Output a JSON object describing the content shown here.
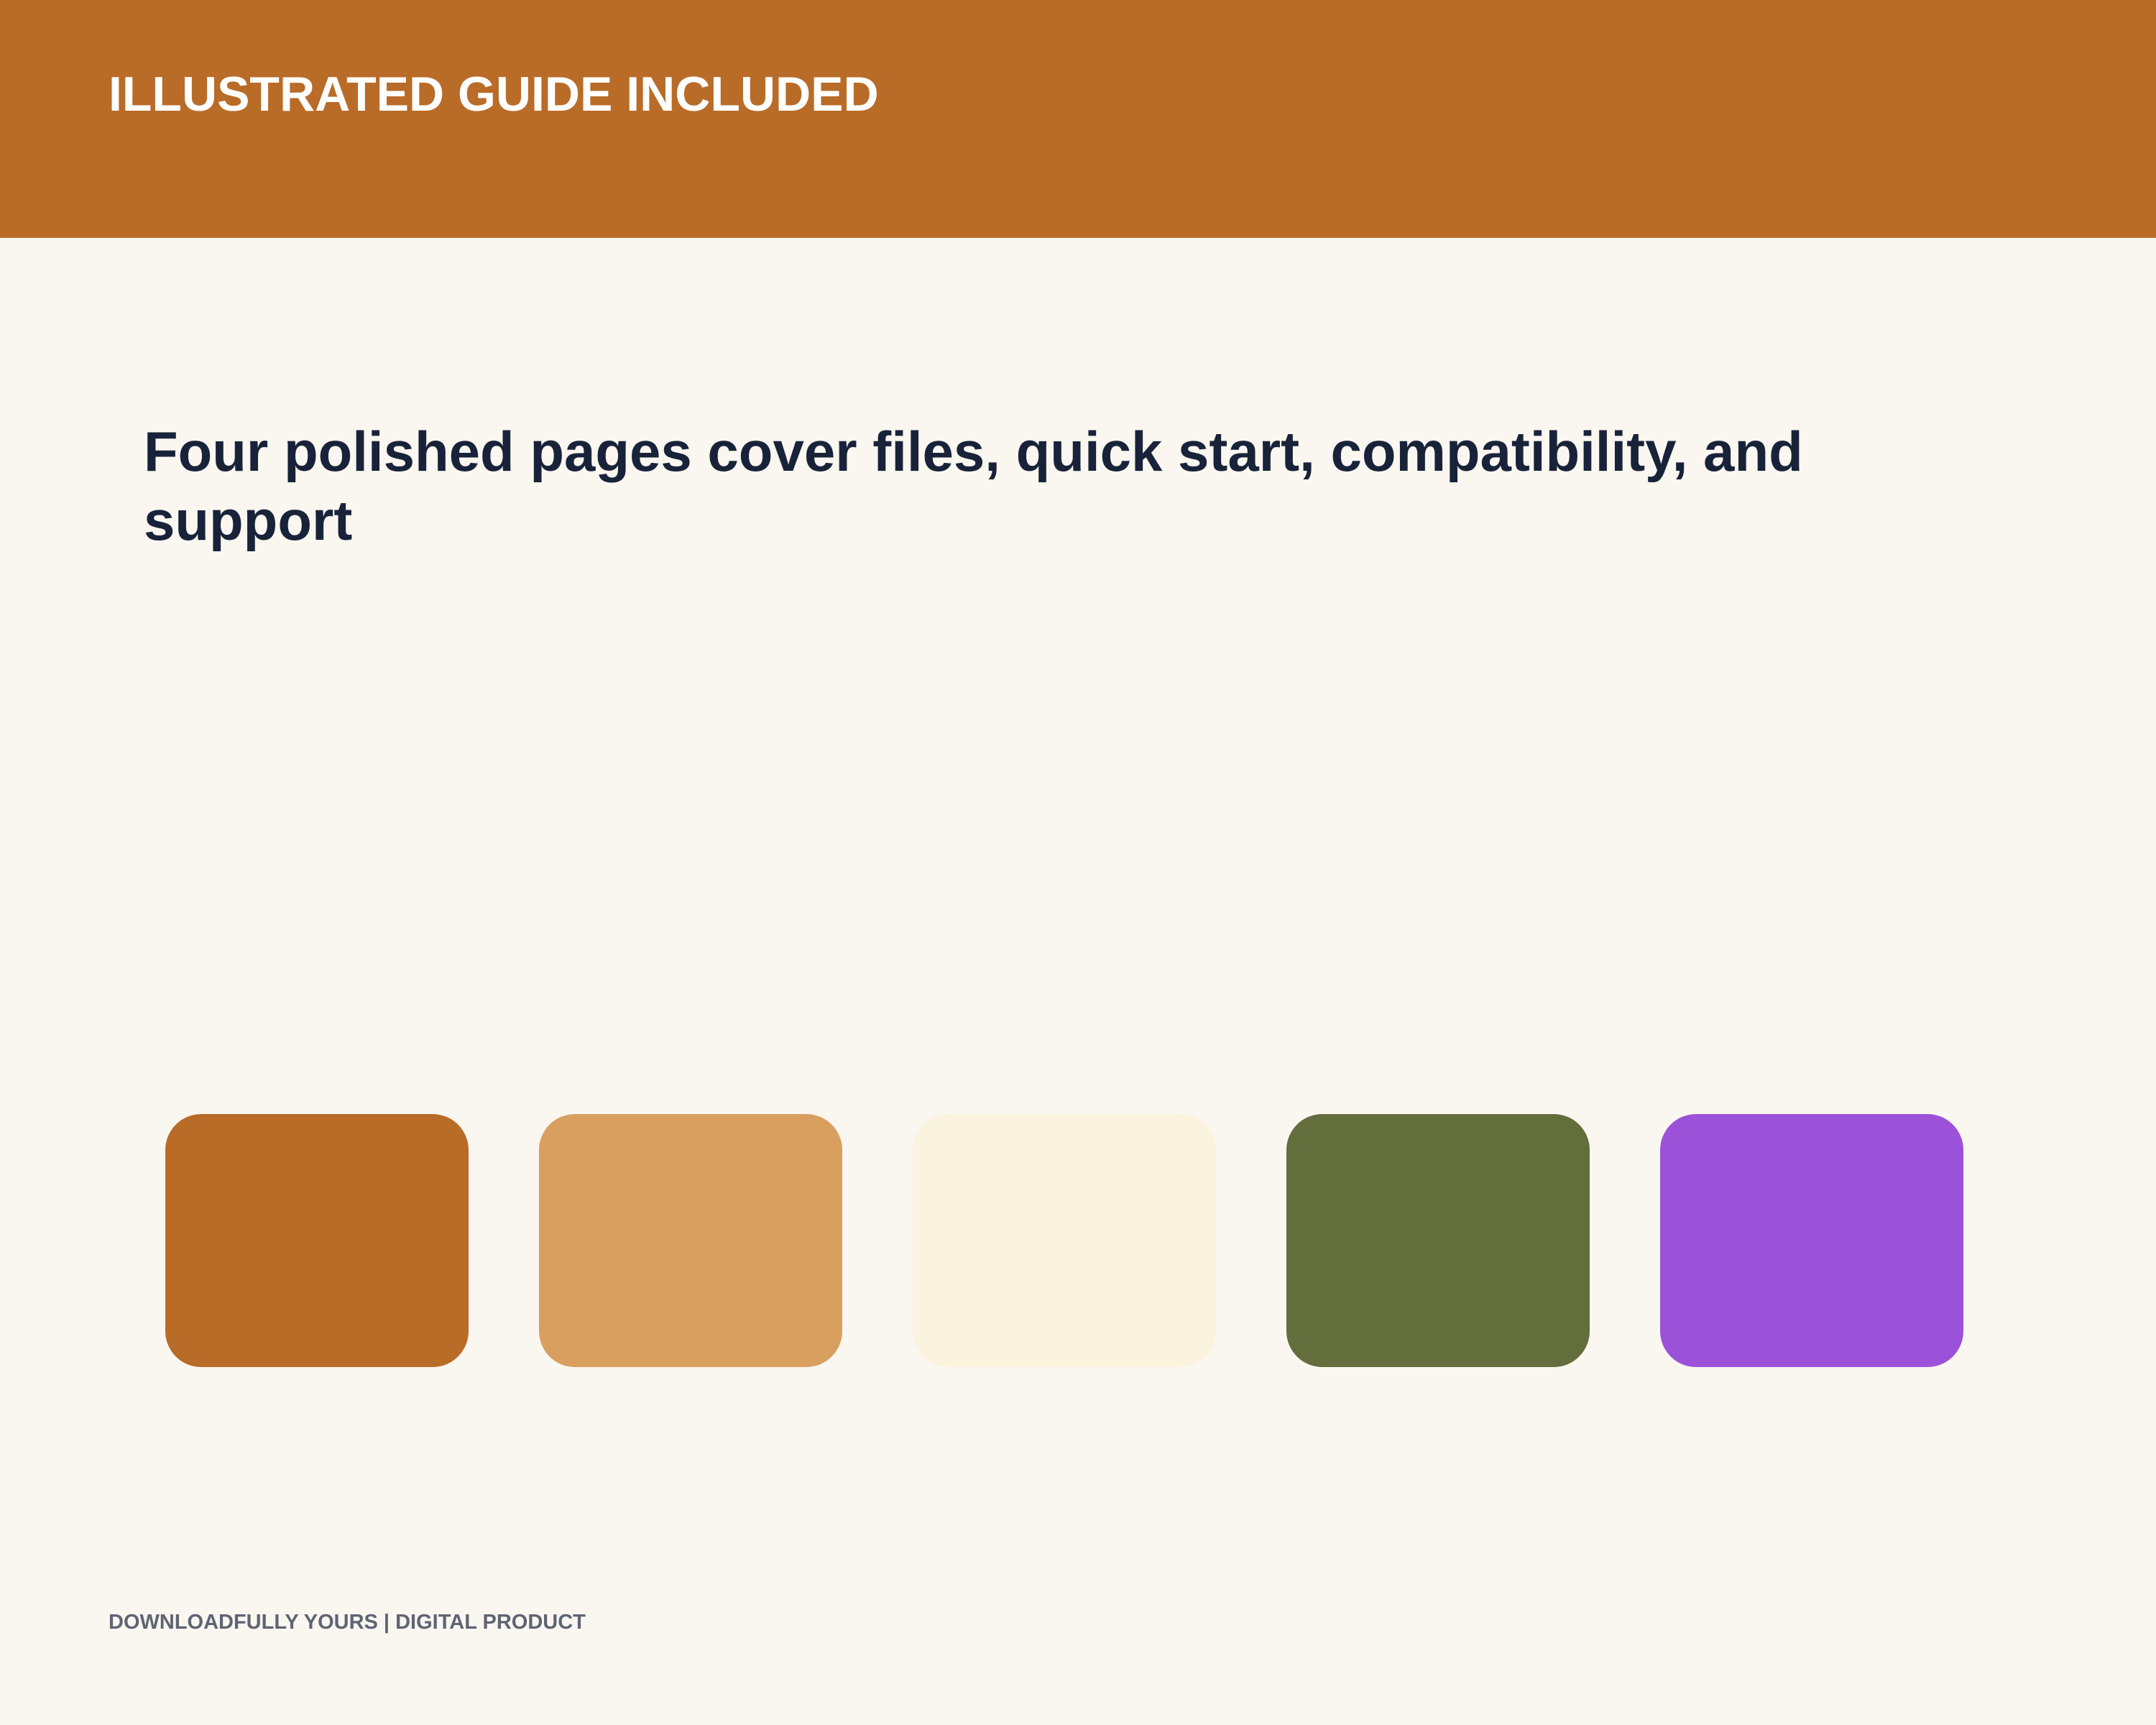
{
  "header": {
    "title": "ILLUSTRATED GUIDE INCLUDED",
    "background_color": "#b96b28"
  },
  "main": {
    "headline": "Four polished pages cover files, quick start, compatibility, and support"
  },
  "palette": {
    "swatches": [
      {
        "color": "#b96b28"
      },
      {
        "color": "#d99f5f"
      },
      {
        "color": "#faf4de"
      },
      {
        "color": "#646d3c"
      },
      {
        "color": "#9c51d9"
      }
    ]
  },
  "footer": {
    "text": "DOWNLOADFULLY YOURS | DIGITAL PRODUCT"
  }
}
